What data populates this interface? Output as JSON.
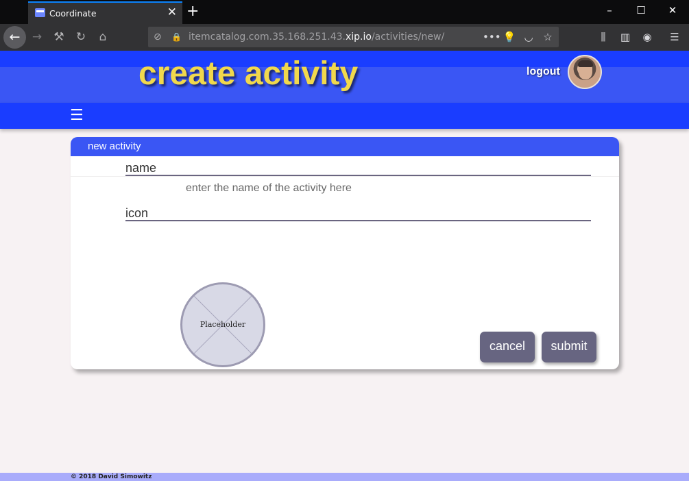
{
  "browser": {
    "tab_title": "Coordinate",
    "tab_close": "✕",
    "new_tab": "+",
    "window_controls": {
      "minimize": "–",
      "maximize": "☐",
      "close": "✕"
    },
    "url_scheme_host_prefix": "itemcatalog.com.35.168.251.43.",
    "url_host": "xip.io",
    "url_path": "/activities/new/",
    "url_more": "•••",
    "icons": {
      "back": "←",
      "forward": "→",
      "tools": "⚒",
      "reload": "↻",
      "home": "⌂",
      "tracking": "⊘",
      "insecure": "🔒",
      "lightbulb": "💡",
      "pocket": "◡",
      "bookmark": "☆",
      "library": "⫼",
      "sidebar": "▥",
      "account": "◉",
      "menu": "☰"
    }
  },
  "header": {
    "title": "create activity",
    "logout_label": "logout",
    "menu_icon": "☰"
  },
  "form": {
    "card_title": "new activity",
    "name_label": "name",
    "name_hint": "enter the name of the activity here",
    "icon_label": "icon",
    "icon_placeholder_text": "Placeholder",
    "cancel_label": "cancel",
    "submit_label": "submit"
  },
  "footer": {
    "copyright": "© 2018 David Simowitz"
  },
  "colors": {
    "header_blue": "#1a3dff",
    "header_mid_blue": "#3a56f4",
    "title_yellow": "#f1d84c",
    "button_gray": "#676581",
    "footer_band": "#a9acfb"
  }
}
